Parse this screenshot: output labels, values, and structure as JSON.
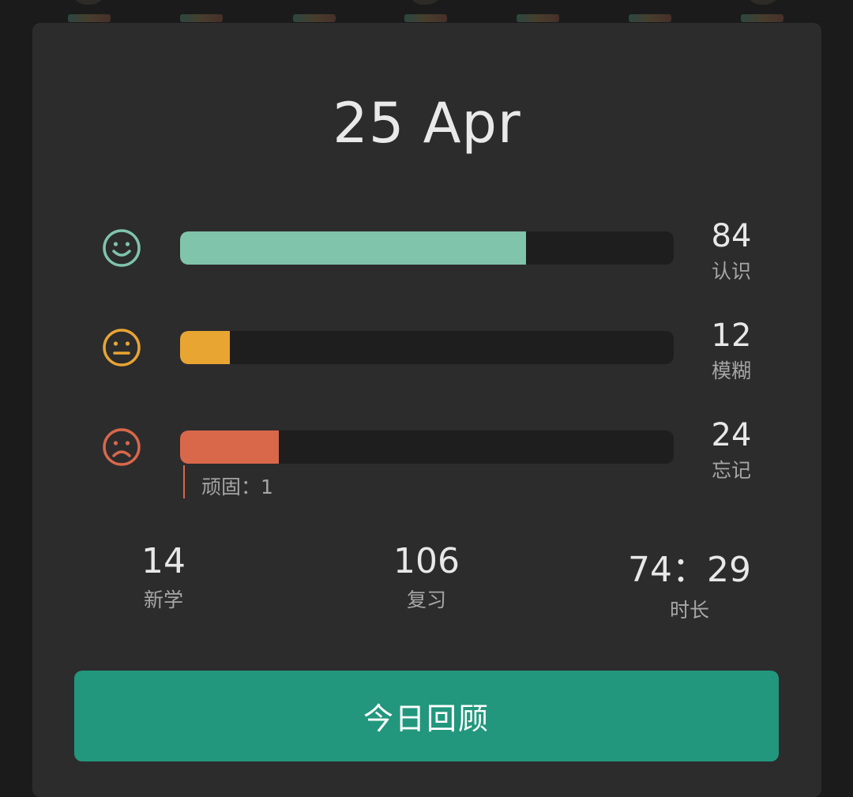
{
  "header": {
    "date": "25 Apr"
  },
  "bars": [
    {
      "id": "know",
      "icon": "smile-face-icon",
      "color": "#7fc4ab",
      "fraction": 0.7,
      "count": "84",
      "label": "认识"
    },
    {
      "id": "fuzzy",
      "icon": "neutral-face-icon",
      "color": "#e8a532",
      "fraction": 0.1,
      "count": "12",
      "label": "模糊"
    },
    {
      "id": "forgot",
      "icon": "sad-face-icon",
      "color": "#d9674a",
      "fraction": 0.2,
      "count": "24",
      "label": "忘记"
    }
  ],
  "stubborn": {
    "label": "顽固：1"
  },
  "stats": [
    {
      "value": "14",
      "label": "新学"
    },
    {
      "value": "106",
      "label": "复习"
    },
    {
      "value": "74：29",
      "label": "时长"
    }
  ],
  "action": {
    "label": "今日回顾",
    "color": "#22977d"
  }
}
